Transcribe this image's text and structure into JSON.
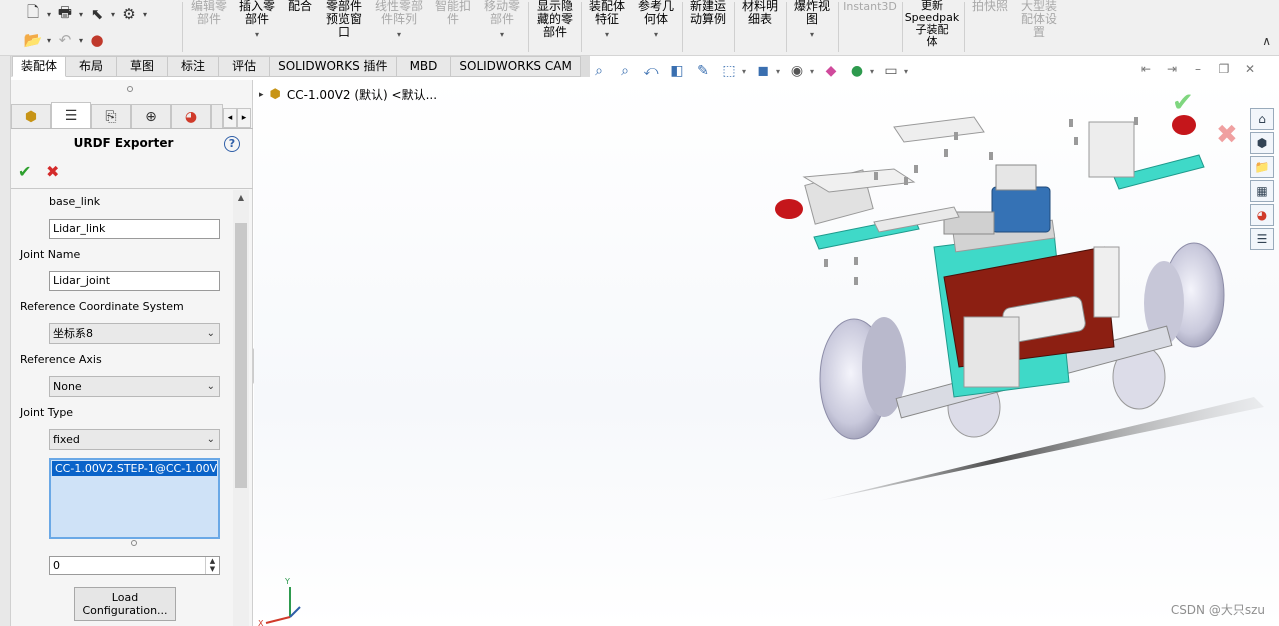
{
  "quick_access": {
    "icons": [
      "new-document-icon",
      "print-icon",
      "select-cursor-icon",
      "options-gear-icon",
      "open-file-icon",
      "undo-icon",
      "traffic-light-icon"
    ]
  },
  "ribbon": {
    "buttons": [
      {
        "label": "编辑零\n部件",
        "disabled": true
      },
      {
        "label": "插入零\n部件",
        "disabled": false
      },
      {
        "label": "配合",
        "disabled": false
      },
      {
        "label": "零部件\n预览窗\n口",
        "disabled": false
      },
      {
        "label": "线性零部\n件阵列",
        "disabled": true
      },
      {
        "label": "智能扣\n件",
        "disabled": true
      },
      {
        "label": "移动零\n部件",
        "disabled": true
      },
      {
        "label": "显示隐\n藏的零\n部件",
        "disabled": false
      },
      {
        "label": "装配体\n特征",
        "disabled": false
      },
      {
        "label": "参考几\n何体",
        "disabled": false
      },
      {
        "label": "新建运\n动算例",
        "disabled": false
      },
      {
        "label": "材料明\n细表",
        "disabled": false
      },
      {
        "label": "爆炸视\n图",
        "disabled": false
      },
      {
        "label": "Instant3D",
        "disabled": true
      },
      {
        "label": "更新\nSpeedpak\n子装配\n体",
        "disabled": false
      },
      {
        "label": "拍快照",
        "disabled": true
      },
      {
        "label": "大型装\n配体设\n置",
        "disabled": true
      }
    ]
  },
  "tabs": [
    "装配体",
    "布局",
    "草图",
    "标注",
    "评估",
    "SOLIDWORKS 插件",
    "MBD",
    "SOLIDWORKS CAM"
  ],
  "panel": {
    "title": "URDF Exporter",
    "parent_link_value": "base_link",
    "link_name_value": "Lidar_link",
    "joint_name_label": "Joint Name",
    "joint_name_value": "Lidar_joint",
    "ref_coord_label": "Reference Coordinate System",
    "ref_coord_value": "坐标系8",
    "ref_axis_label": "Reference Axis",
    "ref_axis_value": "None",
    "joint_type_label": "Joint Type",
    "joint_type_value": "fixed",
    "selected_item": "CC-1.00V2.STEP-1@CC-1.00V2/C",
    "spinner_value": "0",
    "load_button_label": "Load\nConfiguration..."
  },
  "viewport": {
    "tree_node_label": "CC-1.00V2  (默认) <默认...",
    "watermark": "CSDN @大只szu",
    "axis_y": "Y",
    "axis_x": "X"
  },
  "colors": {
    "ribbon_bg": "#f0f0f0",
    "selection_blue": "#0a63c9",
    "ok_green": "#2ea02e",
    "cancel_red": "#d42b2b",
    "teal": "#3fd9c8",
    "pcb_red": "#8c1f12"
  }
}
